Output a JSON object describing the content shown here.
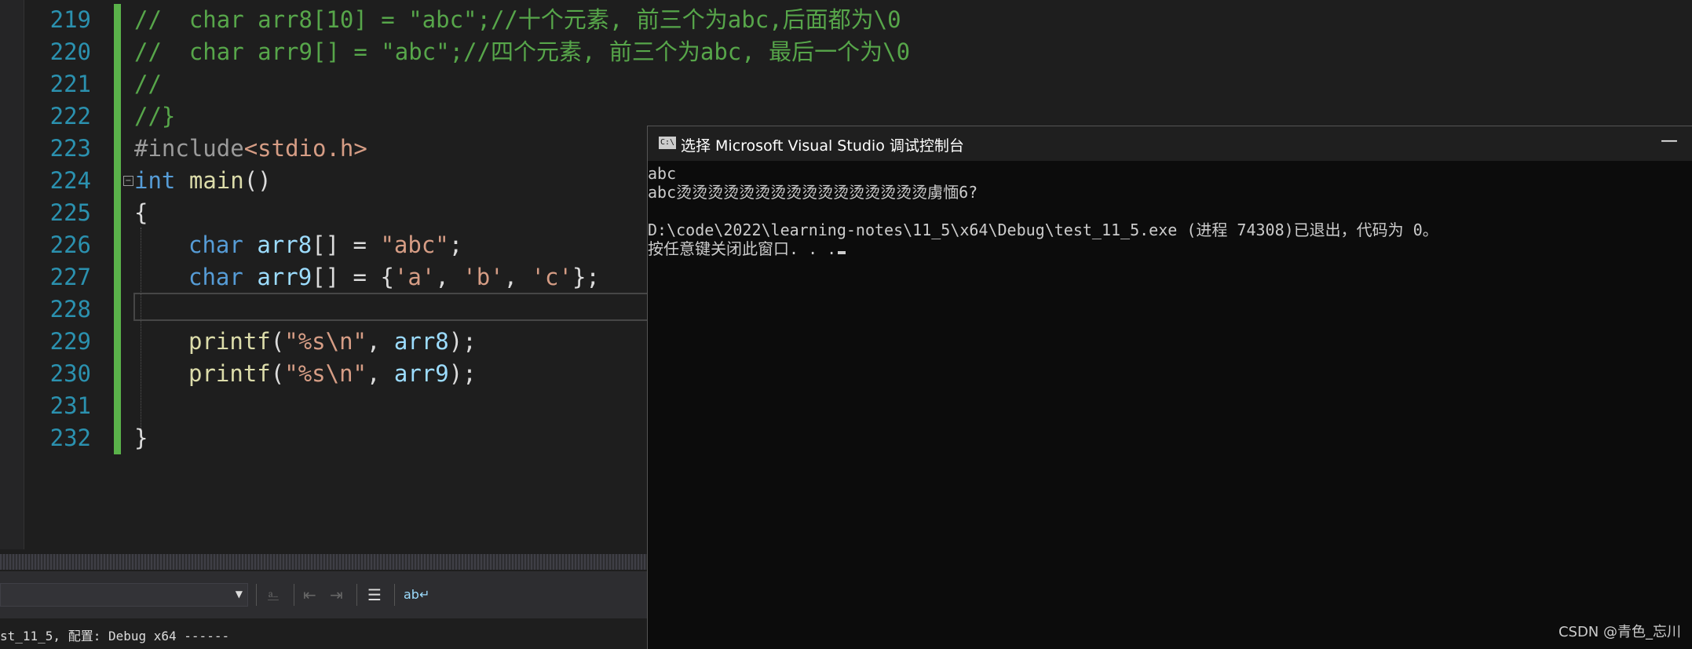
{
  "editor": {
    "lines": [
      {
        "num": "219",
        "comment": "//  char arr8[10] = \"abc\";//十个元素, 前三个为abc,后面都为\\0"
      },
      {
        "num": "220",
        "comment": "//  char arr9[] = \"abc\";//四个元素, 前三个为abc, 最后一个为\\0"
      },
      {
        "num": "221",
        "comment": "//"
      },
      {
        "num": "222",
        "comment": "//}"
      },
      {
        "num": "223",
        "pp": "#include",
        "header": "<stdio.h>"
      },
      {
        "num": "224",
        "kw": "int",
        "fn": "main",
        "punc": "()"
      },
      {
        "num": "225",
        "punc": "{"
      },
      {
        "num": "226",
        "kw": "char",
        "var": "arr8",
        "rest": "[] = ",
        "str": "\"abc\"",
        "end": ";"
      },
      {
        "num": "227",
        "kw": "char",
        "var": "arr9",
        "rest": "[] = {",
        "chars": [
          "'a'",
          "'b'",
          "'c'"
        ],
        "sep": ", ",
        "end": "};"
      },
      {
        "num": "228"
      },
      {
        "num": "229",
        "fn": "printf",
        "open": "(",
        "str": "\"%s\\n\"",
        "sep": ", ",
        "var": "arr8",
        "end": ");"
      },
      {
        "num": "230",
        "fn": "printf",
        "open": "(",
        "str": "\"%s\\n\"",
        "sep": ", ",
        "var": "arr9",
        "end": ");"
      },
      {
        "num": "231"
      },
      {
        "num": "232",
        "punc": "}"
      }
    ]
  },
  "output_status": "st_11_5, 配置: Debug x64 ------",
  "console": {
    "title": "选择 Microsoft Visual Studio 调试控制台",
    "icon_text": "C:\\",
    "minimize_label": "—",
    "lines": [
      "abc",
      "abc烫烫烫烫烫烫烫烫烫烫烫烫烫烫烫烫虜愐6?",
      "",
      "D:\\code\\2022\\learning-notes\\11_5\\x64\\Debug\\test_11_5.exe (进程 74308)已退出，代码为 0。",
      "按任意键关闭此窗口. . ."
    ]
  },
  "watermark": "CSDN @青色_忘川",
  "colors": {
    "editor_bg": "#1e1e1e",
    "line_number": "#2b91af",
    "comment": "#57a64a",
    "keyword": "#569cd6",
    "string": "#d69d85",
    "console_bg": "#0c0c0c"
  }
}
